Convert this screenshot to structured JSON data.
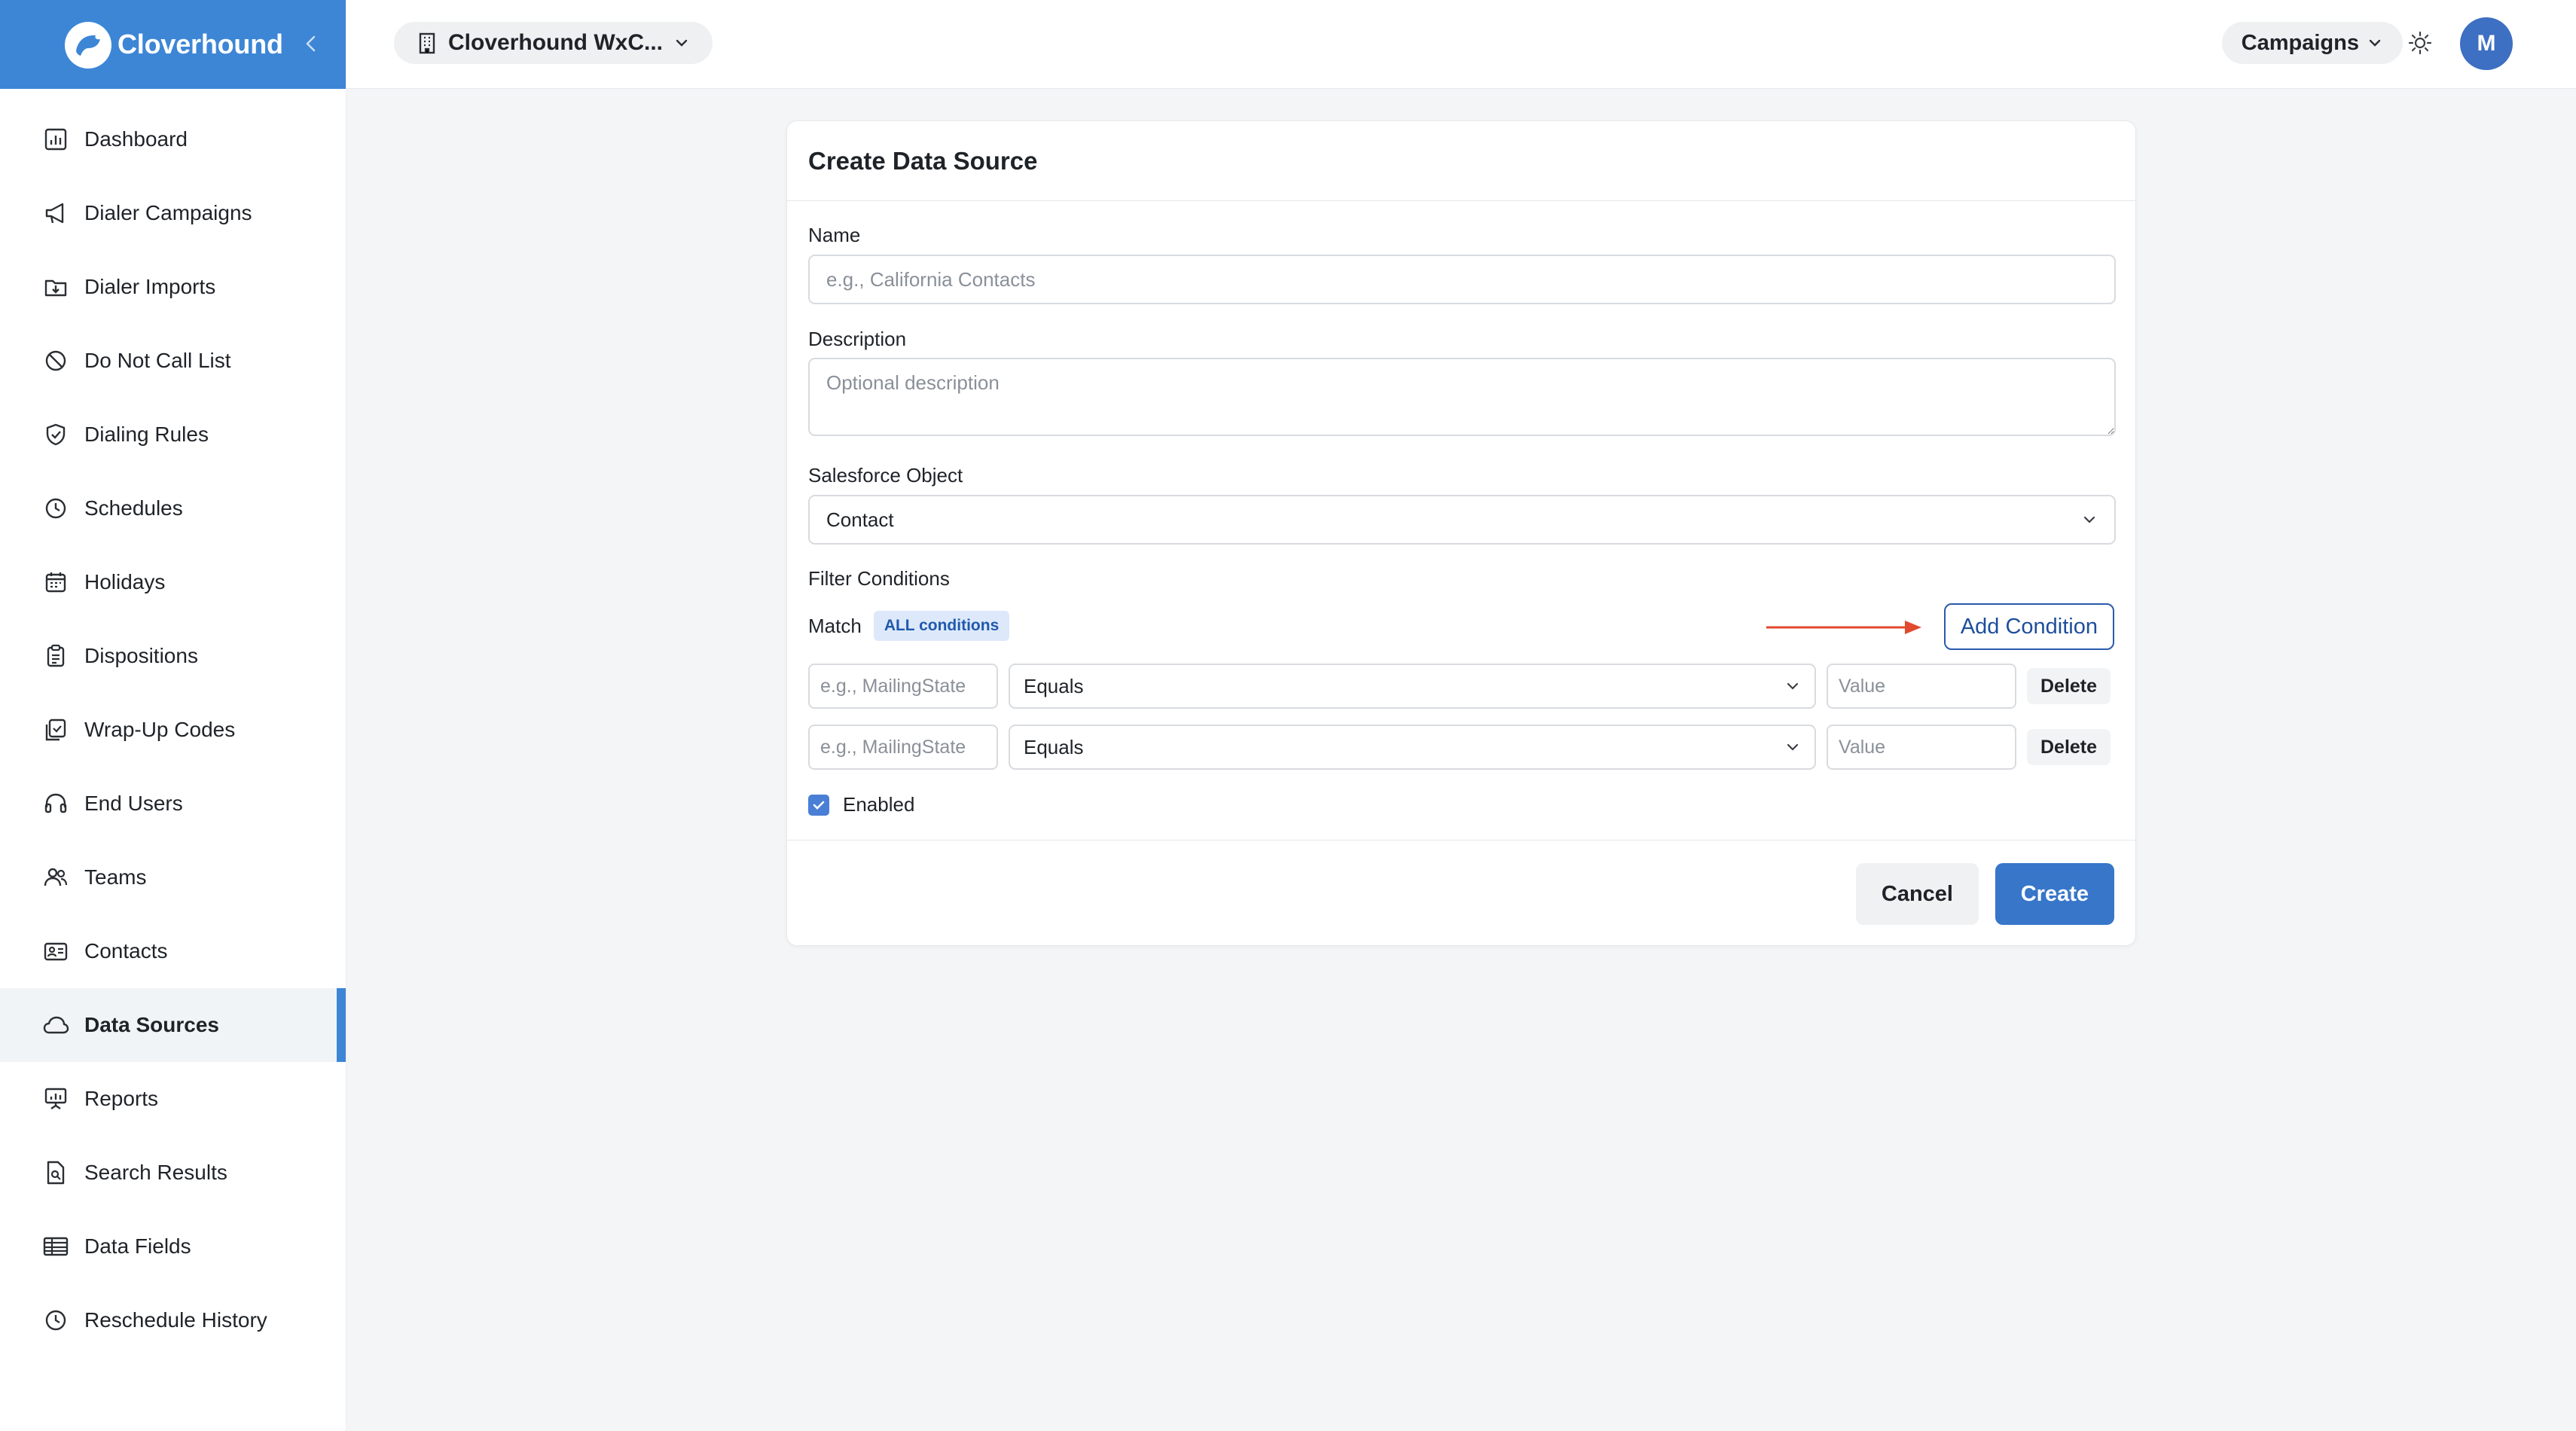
{
  "brand": {
    "name": "Cloverhound"
  },
  "topbar": {
    "org_name": "Cloverhound WxC...",
    "campaigns_label": "Campaigns",
    "avatar_initial": "M"
  },
  "sidebar": {
    "active": "Data Sources",
    "items": [
      {
        "label": "Dashboard",
        "icon": "dashboard-icon"
      },
      {
        "label": "Dialer Campaigns",
        "icon": "megaphone-icon"
      },
      {
        "label": "Dialer Imports",
        "icon": "import-folder-icon"
      },
      {
        "label": "Do Not Call List",
        "icon": "ban-icon"
      },
      {
        "label": "Dialing Rules",
        "icon": "shield-icon"
      },
      {
        "label": "Schedules",
        "icon": "clock-icon"
      },
      {
        "label": "Holidays",
        "icon": "calendar-icon"
      },
      {
        "label": "Dispositions",
        "icon": "clipboard-icon"
      },
      {
        "label": "Wrap-Up Codes",
        "icon": "clipboard-check-icon"
      },
      {
        "label": "End Users",
        "icon": "headset-icon"
      },
      {
        "label": "Teams",
        "icon": "users-icon"
      },
      {
        "label": "Contacts",
        "icon": "id-card-icon"
      },
      {
        "label": "Data Sources",
        "icon": "cloud-icon"
      },
      {
        "label": "Reports",
        "icon": "presentation-icon"
      },
      {
        "label": "Search Results",
        "icon": "file-search-icon"
      },
      {
        "label": "Data Fields",
        "icon": "table-icon"
      },
      {
        "label": "Reschedule History",
        "icon": "history-clock-icon"
      }
    ]
  },
  "form": {
    "title": "Create Data Source",
    "name_label": "Name",
    "name_placeholder": "e.g., California Contacts",
    "name_value": "",
    "description_label": "Description",
    "description_placeholder": "Optional description",
    "description_value": "",
    "object_label": "Salesforce Object",
    "object_value": "Contact",
    "filter_label": "Filter Conditions",
    "match_label": "Match",
    "match_badge": "ALL conditions",
    "add_condition_label": "Add Condition",
    "conditions": [
      {
        "field_placeholder": "e.g., MailingState",
        "field_value": "",
        "operator": "Equals",
        "value_placeholder": "Value",
        "value": "",
        "delete_label": "Delete"
      },
      {
        "field_placeholder": "e.g., MailingState",
        "field_value": "",
        "operator": "Equals",
        "value_placeholder": "Value",
        "value": "",
        "delete_label": "Delete"
      }
    ],
    "enabled_label": "Enabled",
    "enabled": true,
    "cancel_label": "Cancel",
    "create_label": "Create"
  },
  "colors": {
    "brand": "#3d86d6",
    "primary_button": "#3776c9",
    "annotation_arrow": "#e04a2f"
  }
}
